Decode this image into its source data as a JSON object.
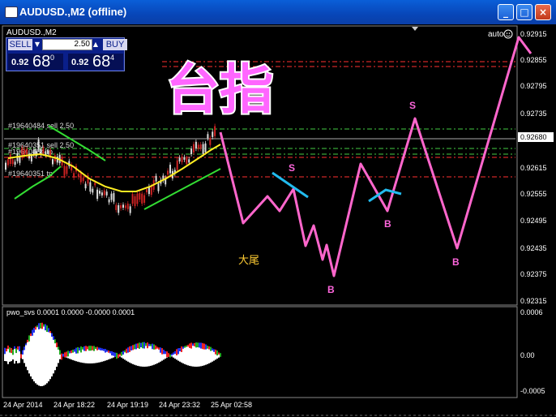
{
  "window": {
    "title": "AUDUSD.,M2 (offline)",
    "controls": [
      "_",
      "□",
      "×"
    ]
  },
  "chart": {
    "symbol_label": "AUDUSD.,M2",
    "auto_label": "auto",
    "overlay_title": "台指",
    "note_text": "大尾",
    "order_labels": [
      "#19640484 sell 2.50",
      "#19640351 sell 2.50",
      "#19640484 tp",
      "#19640351 tp"
    ],
    "price_axis": [
      "0.92915",
      "0.92855",
      "0.92795",
      "0.92735",
      "0.92680",
      "0.92615",
      "0.92555",
      "0.92495",
      "0.92435",
      "0.92375",
      "0.92315"
    ],
    "current_price": "0.92680",
    "time_axis": [
      "24 Apr 2014",
      "24 Apr 18:22",
      "24 Apr 19:19",
      "24 Apr 23:32",
      "25 Apr 02:58"
    ],
    "markers": [
      {
        "letter": "S"
      },
      {
        "letter": "S"
      },
      {
        "letter": "B"
      },
      {
        "letter": "B"
      },
      {
        "letter": "B"
      }
    ]
  },
  "trade_panel": {
    "sell_label": "SELL",
    "buy_label": "BUY",
    "lot_value": "2.50",
    "bid_prefix": "0.92",
    "bid_big": "68",
    "bid_sup": "0",
    "ask_prefix": "0.92",
    "ask_big": "68",
    "ask_sup": "4"
  },
  "indicator": {
    "label": "pwo_svs 0.0001 0.0000 -0.0000 0.0001",
    "axis": [
      "0.0006",
      "0.00",
      "-0.0005"
    ]
  },
  "colors": {
    "pink_path": "#ff66cc",
    "marker_color": "#ff66dd",
    "ma_yellow": "#ffee22",
    "channel_green": "#33dd33",
    "order_red": "#ff3030",
    "cyan": "#22bbee"
  }
}
